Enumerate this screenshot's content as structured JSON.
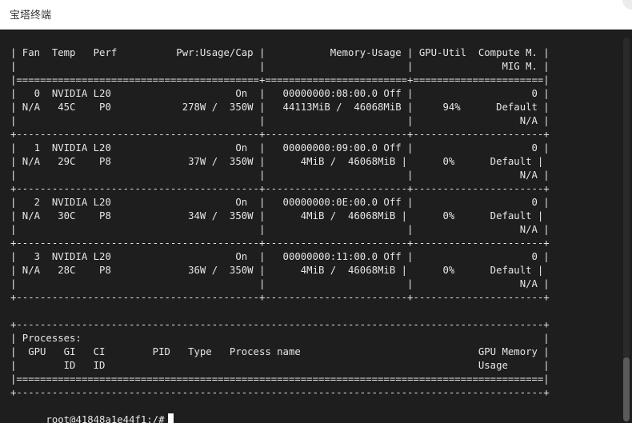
{
  "window": {
    "title": "宝塔终端"
  },
  "terminal": {
    "lines": [
      "| Fan  Temp   Perf          Pwr:Usage/Cap |           Memory-Usage | GPU-Util  Compute M. |",
      "|                                         |                        |               MIG M. |",
      "|=========================================+========================+======================|",
      "|   0  NVIDIA L20                     On  |   00000000:08:00.0 Off |                    0 |",
      "| N/A   45C    P0            278W /  350W |   44113MiB /  46068MiB |     94%      Default |",
      "|                                         |                        |                  N/A |",
      "+-----------------------------------------+------------------------+----------------------+",
      "|   1  NVIDIA L20                     On  |   00000000:09:00.0 Off |                    0 |",
      "| N/A   29C    P8             37W /  350W |      4MiB /  46068MiB |      0%      Default |",
      "|                                         |                        |                  N/A |",
      "+-----------------------------------------+------------------------+----------------------+",
      "|   2  NVIDIA L20                     On  |   00000000:0E:00.0 Off |                    0 |",
      "| N/A   30C    P8             34W /  350W |      4MiB /  46068MiB |      0%      Default |",
      "|                                         |                        |                  N/A |",
      "+-----------------------------------------+------------------------+----------------------+",
      "|   3  NVIDIA L20                     On  |   00000000:11:00.0 Off |                    0 |",
      "| N/A   28C    P8             36W /  350W |      4MiB /  46068MiB |      0%      Default |",
      "|                                         |                        |                  N/A |",
      "+-----------------------------------------+------------------------+----------------------+",
      "",
      "+-----------------------------------------------------------------------------------------+",
      "| Processes:                                                                              |",
      "|  GPU   GI   CI        PID   Type   Process name                              GPU Memory |",
      "|        ID   ID                                                               Usage      |",
      "|=========================================================================================|",
      "+-----------------------------------------------------------------------------------------+"
    ],
    "prompt": "root@41848a1e44f1:/#"
  }
}
